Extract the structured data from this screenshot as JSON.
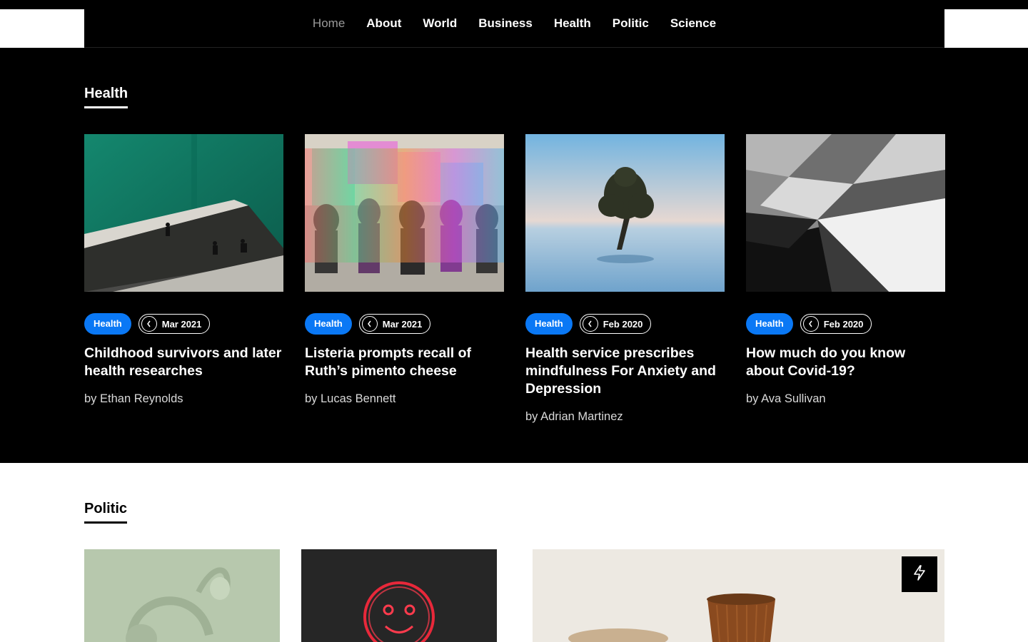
{
  "nav": {
    "items": [
      {
        "label": "Home",
        "active": true
      },
      {
        "label": "About"
      },
      {
        "label": "World"
      },
      {
        "label": "Business"
      },
      {
        "label": "Health"
      },
      {
        "label": "Politic"
      },
      {
        "label": "Science"
      }
    ]
  },
  "health_section": {
    "title": "Health",
    "cards": [
      {
        "tag": "Health",
        "date": "Mar 2021",
        "title": "Childhood survivors and later health researches",
        "byline": "by Ethan Reynolds",
        "image": "green-staircase-photo"
      },
      {
        "tag": "Health",
        "date": "Mar 2021",
        "title": "Listeria prompts recall of Ruth’s pimento cheese",
        "byline": "by Lucas Bennett",
        "image": "colorful-silhouettes-photo"
      },
      {
        "tag": "Health",
        "date": "Feb 2020",
        "title": "Health service prescribes mindfulness For Anxiety and Depression",
        "byline": "by Adrian Martinez",
        "image": "tree-in-sea-photo"
      },
      {
        "tag": "Health",
        "date": "Feb 2020",
        "title": "How much do you know about Covid-19?",
        "byline": "by Ava Sullivan",
        "image": "geometric-architecture-photo"
      }
    ]
  },
  "politic_section": {
    "title": "Politic",
    "tiles": [
      {
        "image": "headphones-photo"
      },
      {
        "image": "neon-smiley-photo"
      },
      {
        "image": "amber-glass-photo",
        "badge_icon": "lightning-icon"
      }
    ]
  },
  "colors": {
    "accent": "#0a78f5",
    "background_dark": "#000000",
    "background_light": "#ffffff"
  }
}
